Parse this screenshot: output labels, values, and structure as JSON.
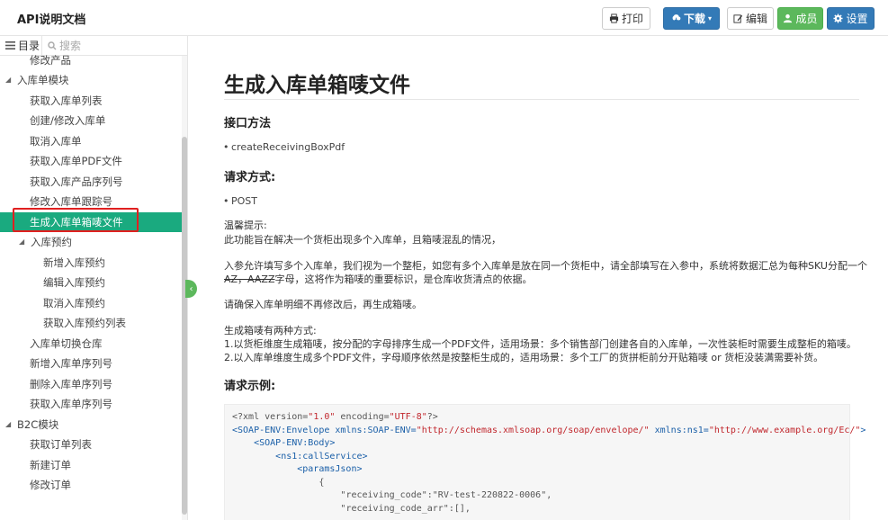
{
  "header": {
    "title": "API说明文档",
    "buttons": {
      "print": "打印",
      "download": "下载",
      "edit": "编辑",
      "members": "成员",
      "settings": "设置"
    }
  },
  "sidebar": {
    "toc_label": "目录",
    "search_placeholder": "搜索",
    "items": [
      {
        "label": "修改产品"
      },
      {
        "label": "入库单模块"
      },
      {
        "label": "获取入库单列表"
      },
      {
        "label": "创建/修改入库单"
      },
      {
        "label": "取消入库单"
      },
      {
        "label": "获取入库单PDF文件"
      },
      {
        "label": "获取入库产品序列号"
      },
      {
        "label": "修改入库单跟踪号"
      },
      {
        "label": "生成入库单箱唛文件"
      },
      {
        "label": "入库预约"
      },
      {
        "label": "新增入库预约"
      },
      {
        "label": "编辑入库预约"
      },
      {
        "label": "取消入库预约"
      },
      {
        "label": "获取入库预约列表"
      },
      {
        "label": "入库单切换仓库"
      },
      {
        "label": "新增入库单序列号"
      },
      {
        "label": "删除入库单序列号"
      },
      {
        "label": "获取入库单序列号"
      },
      {
        "label": "B2C模块"
      },
      {
        "label": "获取订单列表"
      },
      {
        "label": "新建订单"
      },
      {
        "label": "修改订单"
      }
    ]
  },
  "content": {
    "title": "生成入库单箱唛文件",
    "method_heading": "接口方法",
    "method_value": "createReceivingBoxPdf",
    "request_heading": "请求方式:",
    "request_value": "POST",
    "tip_label": "温馨提示:",
    "tip_text": "此功能旨在解决一个货柜出现多个入库单，且箱唛混乱的情况，",
    "para1_a": "入参允许填写多个入库单，我们视为一个整柜，如您有多个入库单是放在同一个货柜中，请全部填写在入参中，系统将数据汇总为每种SKU分配一个",
    "para1_b_strike": "AZ，AAZZ",
    "para1_b_rest": "字母，这将作为箱唛的重要标识，是仓库收货清点的依据。",
    "para2": "请确保入库单明细不再修改后，再生成箱唛。",
    "modes_label": "生成箱唛有两种方式:",
    "mode1": "1.以货柜维度生成箱唛，按分配的字母排序生成一个PDF文件，适用场景：多个销售部门创建各自的入库单，一次性装柜时需要生成整柜的箱唛。",
    "mode2": "2.以入库单维度生成多个PDF文件，字母顺序依然是按整柜生成的，适用场景：多个工厂的货拼柜前分开贴箱唛 or 货柜没装满需要补货。",
    "example_heading": "请求示例:",
    "code": {
      "l1_pre": "<?xml version=",
      "l1_v1": "\"1.0\"",
      "l1_mid": " encoding=",
      "l1_v2": "\"UTF-8\"",
      "l1_end": "?>",
      "l2_tag": "<SOAP-ENV:Envelope",
      "l2_attr1": " xmlns:SOAP-ENV=",
      "l2_v1": "\"http://schemas.xmlsoap.org/soap/envelope/\"",
      "l2_attr2": " xmlns:ns1=",
      "l2_v2": "\"http://www.example.org/Ec/\"",
      "l2_end": ">",
      "l3": "<SOAP-ENV:Body>",
      "l4": "<ns1:callService>",
      "l5": "<paramsJson>",
      "l6": "{",
      "l7_key": "\"receiving_code\"",
      "l7_sep": ":",
      "l7_val": "\"RV-test-220822-0006\"",
      "l7_end": ",",
      "l8_key": "\"receiving_code_arr\"",
      "l8_rest": ":[],"
    }
  }
}
